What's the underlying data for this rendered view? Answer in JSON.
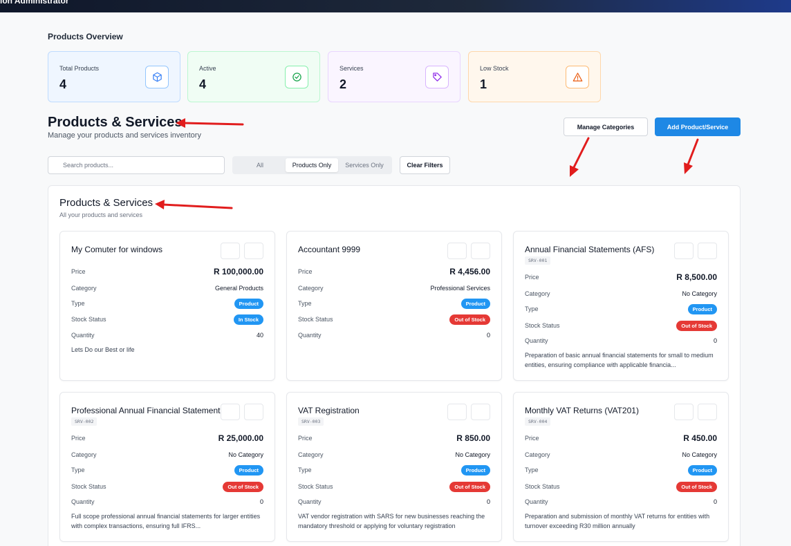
{
  "topbar": {
    "title": "tion Administrator"
  },
  "overview": {
    "title": "Products Overview",
    "stats": [
      {
        "label": "Total Products",
        "value": "4",
        "icon": "box-icon",
        "color": "#3b82f6"
      },
      {
        "label": "Active",
        "value": "4",
        "icon": "check-circle-icon",
        "color": "#16a34a"
      },
      {
        "label": "Services",
        "value": "2",
        "icon": "tag-icon",
        "color": "#9333ea"
      },
      {
        "label": "Low Stock",
        "value": "1",
        "icon": "alert-triangle-icon",
        "color": "#ea580c"
      }
    ]
  },
  "header": {
    "title": "Products & Services",
    "subtitle": "Manage your products and services inventory",
    "manage_label": "Manage Categories",
    "add_label": "Add Product/Service"
  },
  "filters": {
    "search_placeholder": "Search products...",
    "segments": [
      "All",
      "Products Only",
      "Services Only"
    ],
    "selected": "Products Only",
    "clear_label": "Clear Filters"
  },
  "panel": {
    "title": "Products & Services",
    "subtitle": "All your products and services"
  },
  "labels": {
    "price": "Price",
    "category": "Category",
    "type": "Type",
    "stock_status": "Stock Status",
    "quantity": "Quantity"
  },
  "cards": [
    {
      "name": "My Comuter for windows",
      "code": "",
      "price": "R 100,000.00",
      "category": "General Products",
      "type": "Product",
      "stock": "In Stock",
      "stock_color": "#2196f3",
      "quantity": "40",
      "description": "Lets Do our Best or life"
    },
    {
      "name": "Accountant 9999",
      "code": "",
      "price": "R 4,456.00",
      "category": "Professional Services",
      "type": "Product",
      "stock": "Out of Stock",
      "stock_color": "#e53935",
      "quantity": "0",
      "description": ""
    },
    {
      "name": "Annual Financial Statements (AFS)",
      "code": "SRV-001",
      "price": "R 8,500.00",
      "category": "No Category",
      "type": "Product",
      "stock": "Out of Stock",
      "stock_color": "#e53935",
      "quantity": "0",
      "description": "Preparation of basic annual financial statements for small to medium entities, ensuring compliance with applicable financia..."
    },
    {
      "name": "Professional Annual Financial Statements",
      "code": "SRV-002",
      "price": "R 25,000.00",
      "category": "No Category",
      "type": "Product",
      "stock": "Out of Stock",
      "stock_color": "#e53935",
      "quantity": "0",
      "description": "Full scope professional annual financial statements for larger entities with complex transactions, ensuring full IFRS..."
    },
    {
      "name": "VAT Registration",
      "code": "SRV-003",
      "price": "R 850.00",
      "category": "No Category",
      "type": "Product",
      "stock": "Out of Stock",
      "stock_color": "#e53935",
      "quantity": "0",
      "description": "VAT vendor registration with SARS for new businesses reaching the mandatory threshold or applying for voluntary registration"
    },
    {
      "name": "Monthly VAT Returns (VAT201)",
      "code": "SRV-004",
      "price": "R 450.00",
      "category": "No Category",
      "type": "Product",
      "stock": "Out of Stock",
      "stock_color": "#e53935",
      "quantity": "0",
      "description": "Preparation and submission of monthly VAT returns for entities with turnover exceeding R30 million annually"
    }
  ]
}
